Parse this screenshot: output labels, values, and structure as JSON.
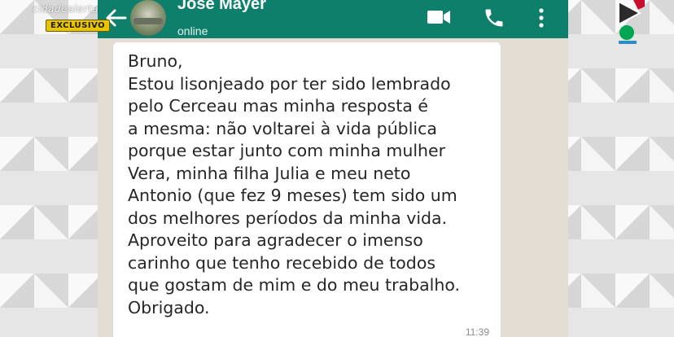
{
  "overlay": {
    "brand_text": "cidadealerta",
    "badge_text": "EXCLUSIVO"
  },
  "chat": {
    "contact_name": "Jose Mayer",
    "status": "online",
    "header_color": "#0e7f6b",
    "icons": [
      "back-arrow-icon",
      "video-call-icon",
      "phone-call-icon",
      "more-vert-icon"
    ]
  },
  "message": {
    "text": "Bruno,\nEstou lisonjeado por ter sido lembrado\npelo Cerceau mas minha resposta é\na mesma: não voltarei à vida pública\nporque estar junto com minha mulher\nVera, minha filha Julia e meu neto\nAntonio (que fez 9 meses) tem sido um\ndos melhores períodos da minha vida.\nAproveito para agradecer o imenso\ncarinho que tenho recebido de todos\nque gostam de mim e do meu trabalho.\nObrigado.",
    "time": "11:39"
  },
  "logo": {
    "name": "record-tv-logo",
    "colors": [
      "#c8102e",
      "#00a651",
      "#2b2b2b"
    ]
  }
}
